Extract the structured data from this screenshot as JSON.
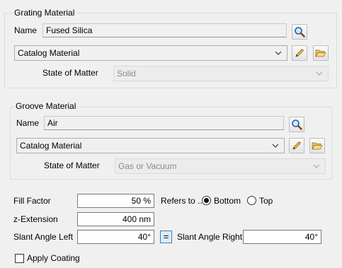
{
  "grating": {
    "legend": "Grating Material",
    "name_label": "Name",
    "name_value": "Fused Silica",
    "catalog_value": "Catalog Material",
    "state_label": "State of Matter",
    "state_value": "Solid"
  },
  "groove": {
    "legend": "Groove Material",
    "name_label": "Name",
    "name_value": "Air",
    "catalog_value": "Catalog Material",
    "state_label": "State of Matter",
    "state_value": "Gas or Vacuum"
  },
  "params": {
    "fill_factor_label": "Fill Factor",
    "fill_factor_value": "50 %",
    "refers_to_label": "Refers to ...",
    "bottom_label": "Bottom",
    "top_label": "Top",
    "selected_ref": "Bottom",
    "z_extension_label": "z-Extension",
    "z_extension_value": "400 nm",
    "slant_left_label": "Slant Angle Left",
    "slant_left_value": "40°",
    "equal_label": "=",
    "slant_right_label": "Slant Angle Right",
    "slant_right_value": "40°",
    "apply_coating_label": "Apply Coating",
    "apply_coating_checked": false
  },
  "icons": {
    "search": "search-icon",
    "edit": "pencil-icon",
    "open": "folder-open-icon",
    "dropdown": "chevron-down-icon"
  },
  "colors": {
    "background": "#f0f0f0",
    "accent_border": "#3c7fb1",
    "accent_fill": "#dcecfc",
    "disabled_text": "#8a8a8a"
  }
}
